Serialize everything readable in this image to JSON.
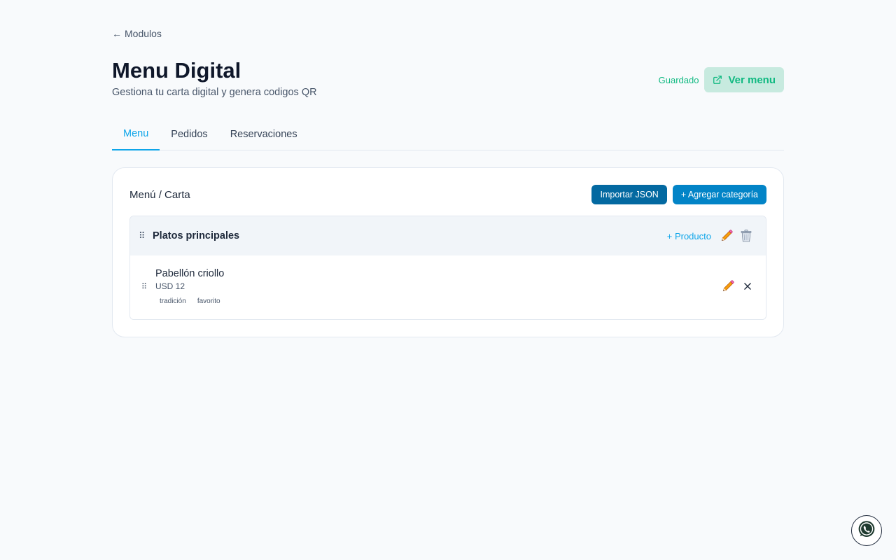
{
  "nav": {
    "back_label": "Modulos"
  },
  "header": {
    "title": "Menu Digital",
    "subtitle": "Gestiona tu carta digital y genera codigos QR",
    "saved_status": "Guardado",
    "view_menu_label": "Ver menu"
  },
  "tabs": [
    {
      "label": "Menu",
      "active": true
    },
    {
      "label": "Pedidos",
      "active": false
    },
    {
      "label": "Reservaciones",
      "active": false
    }
  ],
  "card": {
    "title": "Menú / Carta",
    "import_label": "Importar JSON",
    "add_category_label": "+ Agregar categoría",
    "categories": [
      {
        "name": "Platos principales",
        "add_product_label": "+ Producto",
        "items": [
          {
            "name": "Pabellón criollo",
            "price": "USD 12",
            "tags": [
              "tradición",
              "favorito"
            ]
          }
        ]
      }
    ]
  },
  "colors": {
    "accent": "#0ea5e9",
    "saved": "#10b981",
    "import_button": "#0369a1",
    "add_category_button": "#0284c7"
  },
  "icons": {
    "back": "arrow-left-icon",
    "external_link": "external-link-icon",
    "edit": "pencil-icon",
    "delete_category": "trash-icon",
    "delete_item": "close-icon",
    "drag": "drag-handle-icon",
    "fab": "whatsapp-icon"
  }
}
